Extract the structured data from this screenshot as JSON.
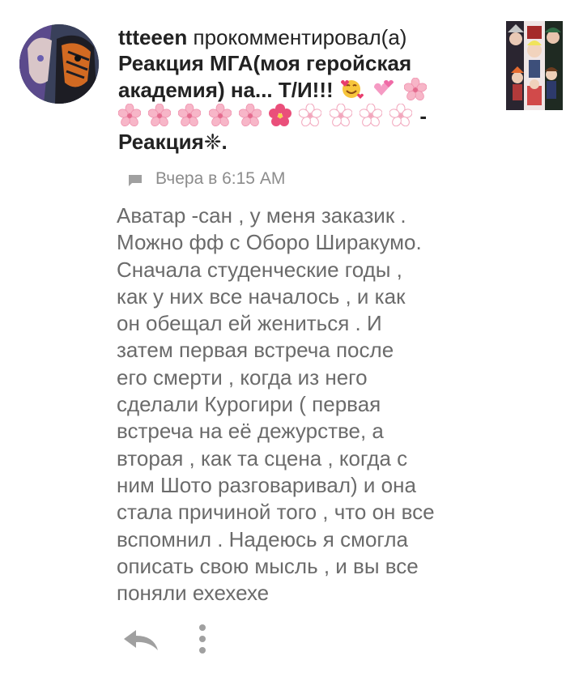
{
  "comment": {
    "username": "ttteeen",
    "action": "прокомментировал(а)",
    "post_title_line1": "Реакция МГА(моя геройская",
    "post_title_line2": "академия) на... Т/И!!!",
    "post_title_end": "-",
    "post_title_last": "Реакция❈.",
    "timestamp": "Вчера в 6:15 AM",
    "body": "Аватар -сан , у меня заказик .\nМожно фф с Оборо Ширакумо.\nСначала студенческие годы ,\nкак у них все началось , и как\nон обещал ей жениться . И\nзатем первая встреча после\nего смерти , когда из него\nсделали Курогири  ( первая\nвстреча на её дежурстве, а\nвторая , как та сцена , когда с\nним Шото разговаривал) и она\nстала причиной того , что он все\nвспомнил . Надеюсь я смогла\nописать свою мысль , и вы все\nпоняли ехехехе"
  },
  "icons": {
    "avatar": "user-avatar",
    "thumbnail": "post-thumbnail",
    "timestamp": "comment-bubble-icon",
    "reply": "reply-arrow-icon",
    "more": "more-vertical-icon"
  },
  "colors": {
    "text_primary": "#222222",
    "text_body": "#6b6b6b",
    "text_meta": "#8c8c8c",
    "icon_gray": "#a0a0a0",
    "flower_pink": "#f7b6c8"
  }
}
